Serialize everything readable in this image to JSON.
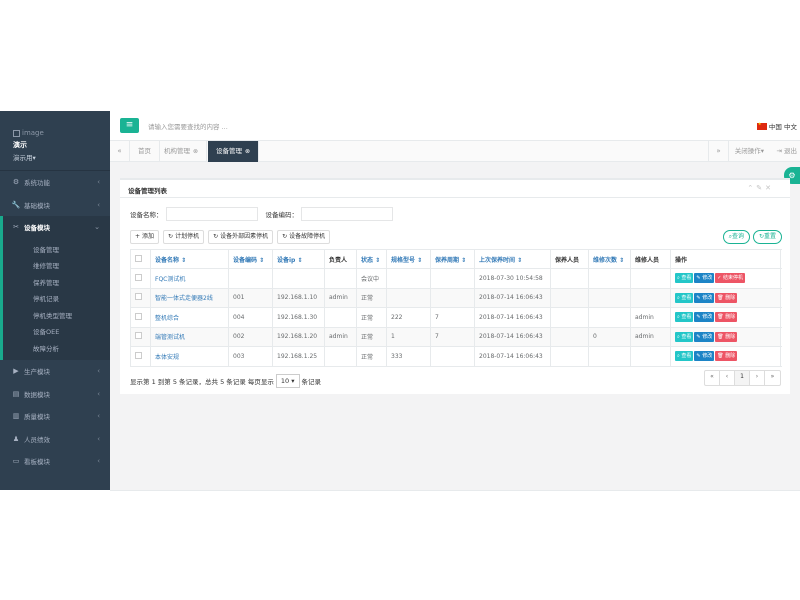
{
  "sidebar": {
    "image_alt": "image",
    "user_name": "演示",
    "user_role": "演示用",
    "nav": [
      {
        "label": "系统功能",
        "icon": "gear-icon",
        "glyph": "⚙"
      },
      {
        "label": "基础模块",
        "icon": "wrench-icon",
        "glyph": "🔧"
      },
      {
        "label": "设备模块",
        "icon": "tools-icon",
        "glyph": "✂"
      },
      {
        "label": "生产模块",
        "icon": "play-icon",
        "glyph": "▶"
      },
      {
        "label": "数据模块",
        "icon": "database-icon",
        "glyph": "▤"
      },
      {
        "label": "质量模块",
        "icon": "check-icon",
        "glyph": "▥"
      },
      {
        "label": "人员绩效",
        "icon": "user-icon",
        "glyph": "♟"
      },
      {
        "label": "看板模块",
        "icon": "monitor-icon",
        "glyph": "▭"
      }
    ],
    "sub_items": [
      "设备管理",
      "维修管理",
      "保养管理",
      "停机记录",
      "停机类型管理",
      "设备OEE",
      "故障分析"
    ]
  },
  "topbar": {
    "search_placeholder": "请输入您需要查找的内容 ...",
    "lang": "中国 中文"
  },
  "tabs": {
    "home": "首页",
    "items": [
      {
        "label": "机构管理",
        "active": false
      },
      {
        "label": "设备管理",
        "active": true
      }
    ],
    "close_ops": "关闭操作",
    "logout": "退出"
  },
  "panel": {
    "title": "设备管理列表",
    "filters": {
      "name_label": "设备名称：",
      "code_label": "设备编码："
    },
    "toolbar": [
      "添加",
      "计划停机",
      "设备外部因素停机",
      "设备故障停机"
    ],
    "search_btn": "查询",
    "reset_btn": "重置",
    "columns": [
      "设备名称",
      "设备编码",
      "设备ip",
      "负责人",
      "状态",
      "规格型号",
      "保养周期",
      "上次保养时间",
      "保养人员",
      "维修次数",
      "维修人员",
      "操作"
    ],
    "rows": [
      {
        "name": "FQC测试机",
        "code": "",
        "ip": "",
        "owner": "",
        "status": "会议中",
        "spec": "",
        "cycle": "",
        "last": "2018-07-30 10:54:58",
        "maint": "",
        "repairs": "",
        "repairer": "",
        "actions": [
          "查看",
          "修改",
          "结束停机"
        ]
      },
      {
        "name": "智能一体式走便器2线",
        "code": "001",
        "ip": "192.168.1.10",
        "owner": "admin",
        "status": "正常",
        "spec": "",
        "cycle": "",
        "last": "2018-07-14 16:06:43",
        "maint": "",
        "repairs": "",
        "repairer": "",
        "actions": [
          "查看",
          "修改",
          "删除"
        ]
      },
      {
        "name": "整机综合",
        "code": "004",
        "ip": "192.168.1.30",
        "owner": "",
        "status": "正常",
        "spec": "222",
        "cycle": "7",
        "last": "2018-07-14 16:06:43",
        "maint": "",
        "repairs": "",
        "repairer": "admin",
        "actions": [
          "查看",
          "修改",
          "删除"
        ]
      },
      {
        "name": "端管测试机",
        "code": "002",
        "ip": "192.168.1.20",
        "owner": "admin",
        "status": "正常",
        "spec": "1",
        "cycle": "7",
        "last": "2018-07-14 16:06:43",
        "maint": "",
        "repairs": "0",
        "repairer": "admin",
        "actions": [
          "查看",
          "修改",
          "删除"
        ]
      },
      {
        "name": "本体安规",
        "code": "003",
        "ip": "192.168.1.25",
        "owner": "",
        "status": "正常",
        "spec": "333",
        "cycle": "",
        "last": "2018-07-14 16:06:43",
        "maint": "",
        "repairs": "",
        "repairer": "",
        "actions": [
          "查看",
          "修改",
          "删除"
        ]
      }
    ],
    "pager": {
      "info": "显示第 1 到第 5 条记录，总共 5 条记录 每页显示",
      "page_size": "10",
      "suffix": "条记录",
      "current": "1"
    }
  }
}
